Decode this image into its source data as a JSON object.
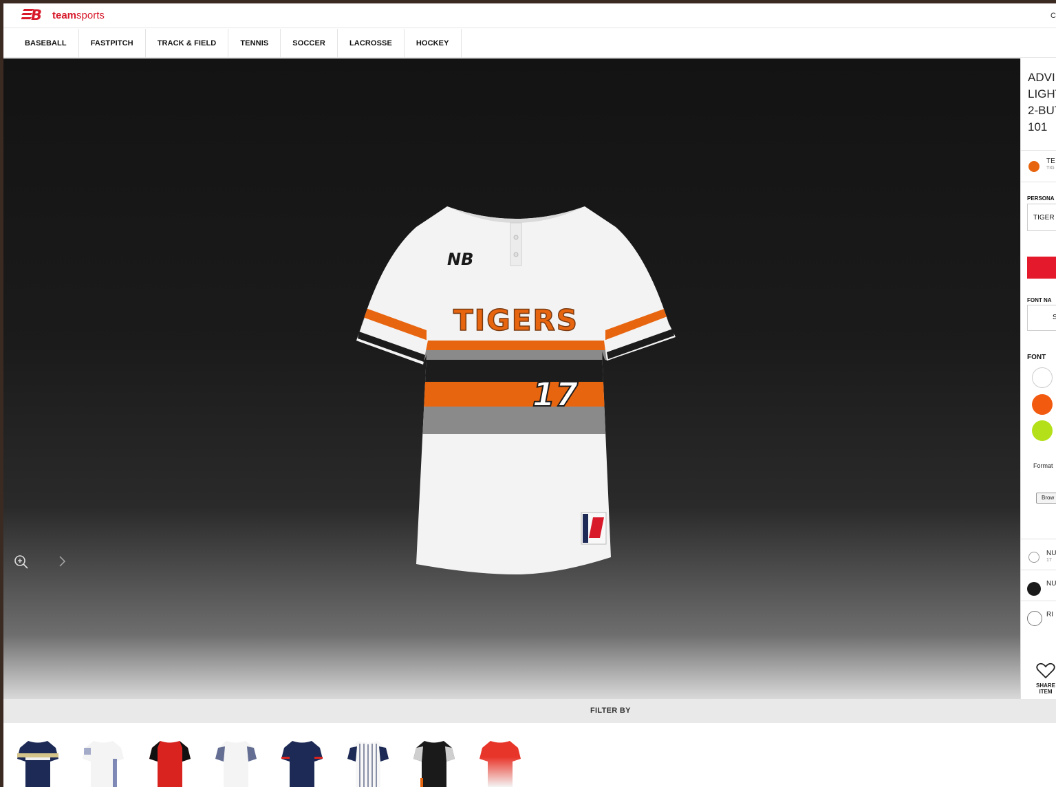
{
  "brand": {
    "mark": "NB",
    "name_bold": "team",
    "name_light": "sports"
  },
  "topbar": {
    "right_text": "C"
  },
  "nav": {
    "items": [
      "BASEBALL",
      "FASTPITCH",
      "TRACK & FIELD",
      "TENNIS",
      "SOCCER",
      "LACROSSE",
      "HOCKEY"
    ]
  },
  "product": {
    "title_lines": [
      "ADVI",
      "LIGHT",
      "2-BUT",
      "101"
    ],
    "jersey_team_text": "TIGERS",
    "jersey_number": "17",
    "jersey_logo": "NB"
  },
  "panel": {
    "team_option": {
      "label": "TE",
      "sub": "TIG",
      "color": "#e8650f"
    },
    "personal_label": "PERSONA",
    "personal_value": "TIGER",
    "font_name_label": "FONT NA",
    "font_name_value": "S",
    "font_color_label": "FONT",
    "font_colors": [
      "#ffffff",
      "#f25a10",
      "#b3e019"
    ],
    "format_label": "Format",
    "browse_label": "Brow",
    "number_option": {
      "label": "NU",
      "sub": "17",
      "color": "#ffffff"
    },
    "number2_option": {
      "label": "NU",
      "color": "#1a1a1a"
    },
    "right_option": {
      "label": "RI"
    },
    "share_label_1": "SHARE",
    "share_label_2": "ITEM"
  },
  "filter": {
    "label": "FILTER BY"
  },
  "colors": {
    "brand_red": "#d7192a",
    "jersey_orange": "#e8650f",
    "jersey_gray": "#8a8a8a",
    "jersey_black": "#1c1c1c"
  },
  "thumbnails": [
    {
      "name": "navy-gold-stripe",
      "body": "#1c2a55",
      "accent": "#d4c48a"
    },
    {
      "name": "white-navy-pattern",
      "body": "#f4f4f4",
      "accent": "#2e3f8a"
    },
    {
      "name": "red-black",
      "body": "#d8231f",
      "accent": "#111111"
    },
    {
      "name": "white-navy-sleeve",
      "body": "#f4f4f4",
      "accent": "#27346a"
    },
    {
      "name": "navy-red-trim",
      "body": "#1c2a55",
      "accent": "#d8231f"
    },
    {
      "name": "pinstripe",
      "body": "#f7f7f7",
      "accent": "#1c2a55"
    },
    {
      "name": "black-camo",
      "body": "#1a1a1a",
      "accent": "#e8650f"
    },
    {
      "name": "red-fade",
      "body": "#e8352a",
      "accent": "#f4f4f4"
    }
  ]
}
